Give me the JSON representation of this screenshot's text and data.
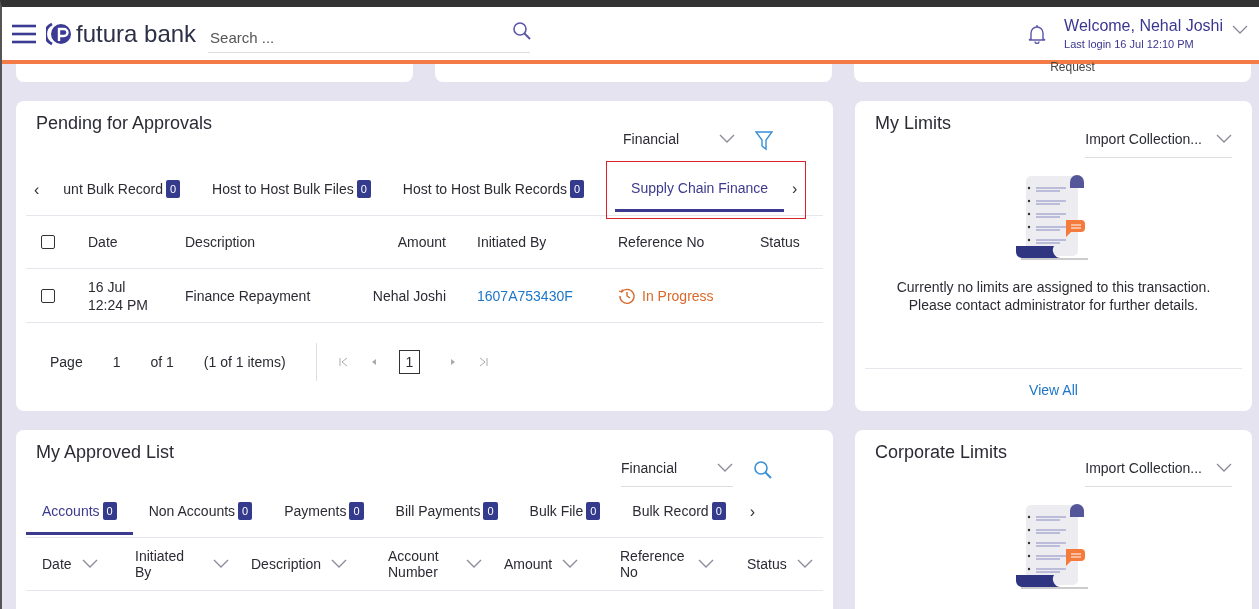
{
  "header": {
    "brand": "futura bank",
    "search": {
      "placeholder": "Search ..."
    },
    "welcome": "Welcome, Nehal Joshi",
    "last_login": "Last login 16 Jul 12:10 PM"
  },
  "top_cards": [
    {
      "kind": "blank"
    },
    {
      "kind": "blank"
    },
    {
      "kind": "text",
      "text": "Request"
    }
  ],
  "pending": {
    "title": "Pending for Approvals",
    "filter": "Financial",
    "prev_arrow": "‹",
    "next_arrow": "›",
    "tabs": [
      {
        "label": "unt Bulk Record",
        "count": "0",
        "selected": false,
        "highlighted": false
      },
      {
        "label": "Host to Host Bulk Files",
        "count": "0",
        "selected": false,
        "highlighted": false
      },
      {
        "label": "Host to Host Bulk Records",
        "count": "0",
        "selected": false,
        "highlighted": false
      },
      {
        "label": "Supply Chain Finance",
        "selected": true,
        "highlighted": true
      }
    ],
    "select_all_checked": false,
    "columns": [
      "Date",
      "Description",
      "Amount",
      "Initiated By",
      "Reference No",
      "Status"
    ],
    "rows": [
      {
        "checked": false,
        "cells": [
          {
            "kind": "text",
            "text": "16 Jul 12:24 PM"
          },
          {
            "kind": "text",
            "text": "Finance Repayment"
          },
          {
            "kind": "text",
            "text": "Nehal Joshi"
          },
          {
            "kind": "link",
            "text": "1607A753430F"
          },
          {
            "kind": "status",
            "text": "In Progress"
          }
        ]
      }
    ],
    "pagination": {
      "label": "Page",
      "page": "1",
      "of": "of 1",
      "summary": "(1 of 1 items)",
      "current": "1"
    }
  },
  "my_limits": {
    "title": "My Limits",
    "filter": "Import Collection...",
    "message": "Currently no limits are assigned to this transaction.\nPlease contact administrator for further details.",
    "link": "View All"
  },
  "approved": {
    "title": "My Approved List",
    "filter": "Financial",
    "next_arrow": "›",
    "tabs": [
      {
        "label": "Accounts",
        "count": "0",
        "selected": true
      },
      {
        "label": "Non Accounts",
        "count": "0",
        "selected": false
      },
      {
        "label": "Payments",
        "count": "0",
        "selected": false
      },
      {
        "label": "Bill Payments",
        "count": "0",
        "selected": false
      },
      {
        "label": "Bulk File",
        "count": "0",
        "selected": false
      },
      {
        "label": "Bulk Record",
        "count": "0",
        "selected": false
      }
    ],
    "columns": [
      "Date",
      "Initiated By",
      "Description",
      "Account Number",
      "Amount",
      "Reference No",
      "Status"
    ]
  },
  "corporate_limits": {
    "title": "Corporate Limits",
    "filter": "Import Collection..."
  }
}
